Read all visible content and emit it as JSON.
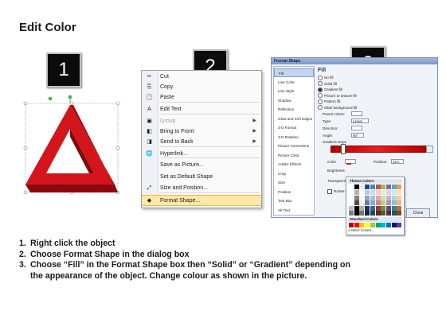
{
  "title": "Edit Color",
  "badges": [
    "1",
    "2",
    "3"
  ],
  "context_menu": {
    "items": [
      {
        "label": "Cut",
        "icon": "scissors-icon",
        "glyph": "✂",
        "submenu": false,
        "disabled": false,
        "highlighted": false
      },
      {
        "label": "Copy",
        "icon": "copy-icon",
        "glyph": "⎘",
        "submenu": false,
        "disabled": false,
        "highlighted": false
      },
      {
        "label": "Paste",
        "icon": "paste-icon",
        "glyph": "📋",
        "submenu": false,
        "disabled": false,
        "highlighted": false
      },
      {
        "label": "Edit Text",
        "icon": "text-icon",
        "glyph": "A",
        "submenu": false,
        "disabled": false,
        "highlighted": false
      },
      {
        "label": "Group",
        "icon": "group-icon",
        "glyph": "▣",
        "submenu": true,
        "disabled": true,
        "highlighted": false
      },
      {
        "label": "Bring to Front",
        "icon": "bring-front-icon",
        "glyph": "◧",
        "submenu": true,
        "disabled": false,
        "highlighted": false
      },
      {
        "label": "Send to Back",
        "icon": "send-back-icon",
        "glyph": "◨",
        "submenu": true,
        "disabled": false,
        "highlighted": false
      },
      {
        "label": "Hyperlink...",
        "icon": "hyperlink-icon",
        "glyph": "🌐",
        "submenu": false,
        "disabled": false,
        "highlighted": false
      },
      {
        "label": "Save as Picture...",
        "icon": "",
        "glyph": "",
        "submenu": false,
        "disabled": false,
        "highlighted": false
      },
      {
        "label": "Set as Default Shape",
        "icon": "",
        "glyph": "",
        "submenu": false,
        "disabled": false,
        "highlighted": false
      },
      {
        "label": "Size and Position...",
        "icon": "size-position-icon",
        "glyph": "⤢",
        "submenu": false,
        "disabled": false,
        "highlighted": false
      },
      {
        "label": "Format Shape...",
        "icon": "format-shape-icon",
        "glyph": "◆",
        "submenu": false,
        "disabled": false,
        "highlighted": true
      }
    ]
  },
  "dialog": {
    "title": "Format Shape",
    "categories": [
      "Fill",
      "Line Color",
      "Line Style",
      "Shadow",
      "Reflection",
      "Glow and Soft Edges",
      "3-D Format",
      "3-D Rotation",
      "Picture Corrections",
      "Picture Color",
      "Artistic Effects",
      "Crop",
      "Size",
      "Position",
      "Text Box",
      "Alt Text"
    ],
    "selected_category": "Fill",
    "heading": "Fill",
    "fill_options": [
      "No fill",
      "Solid fill",
      "Gradient fill",
      "Picture or texture fill",
      "Pattern fill",
      "Slide background fill"
    ],
    "selected_option": "Gradient fill",
    "preset_colors_label": "Preset colors:",
    "type_label": "Type:",
    "type_value": "Linear",
    "direction_label": "Direction:",
    "angle_label": "Angle:",
    "angle_value": "90°",
    "gradient_stops_label": "Gradient stops",
    "color_label": "Color",
    "position_label": "Position:",
    "position_value": "11%",
    "brightness_label": "Brightness",
    "transparency_label": "Transparen",
    "rotate_label": "Rotate w",
    "close_label": "Close",
    "gradient_color": "#d91e1e"
  },
  "palette": {
    "theme_label": "Theme Colors",
    "standard_label": "Standard Colors",
    "more_label": "More Colors...",
    "theme_top": [
      "#ffffff",
      "#000000",
      "#eeece1",
      "#1f497d",
      "#4f81bd",
      "#c0504d",
      "#9bbb59",
      "#8064a2",
      "#4bacc6",
      "#f79646"
    ],
    "standard": [
      "#c00000",
      "#ff0000",
      "#ffc000",
      "#ffff00",
      "#92d050",
      "#00b050",
      "#00b0f0",
      "#0070c0",
      "#002060",
      "#7030a0"
    ]
  },
  "steps": [
    {
      "n": "1.",
      "text": "Right click the object"
    },
    {
      "n": "2.",
      "text": "Choose Format Shape in the dialog box"
    },
    {
      "n": "3.",
      "text": "Choose “Fill” in the Format Shape box then “Solid” or “Gradient” depending on the appearance of the object. Change colour as shown in the picture."
    }
  ],
  "colors": {
    "shape_red": "#d4151c",
    "shape_dark": "#8c0a0f",
    "highlight": "#fde8a8"
  }
}
